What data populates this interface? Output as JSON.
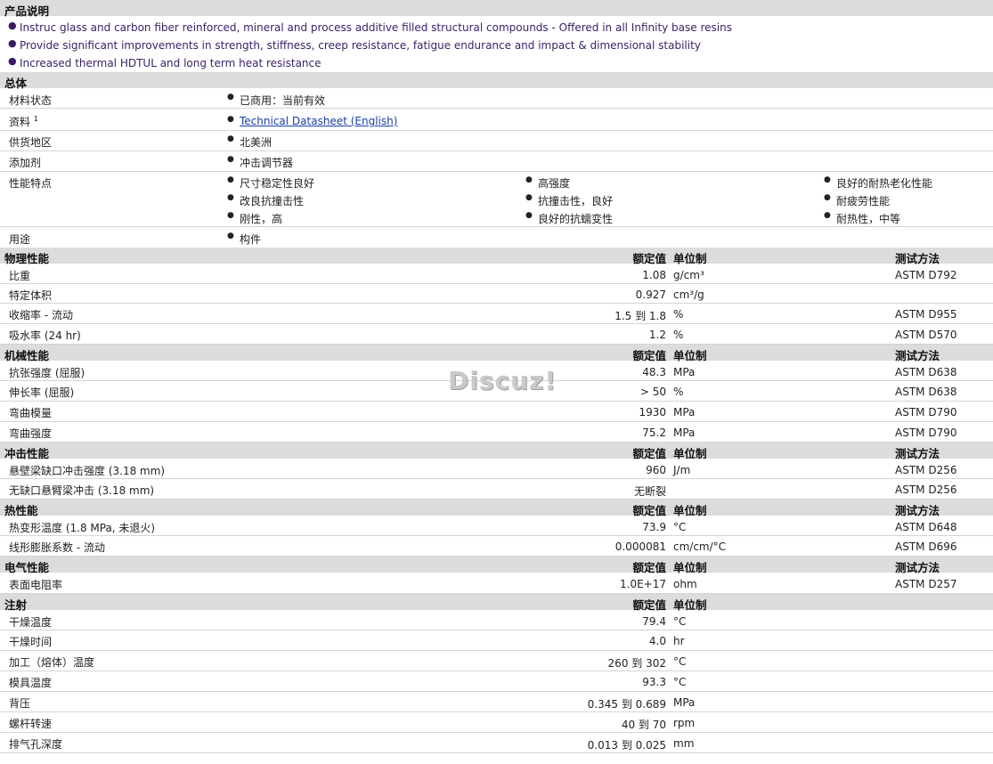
{
  "description": {
    "title": "产品说明",
    "bullets": [
      "Instruc glass and carbon fiber reinforced, mineral and process additive filled structural compounds - Offered in all Infinity base resins",
      "Provide significant improvements in strength, stiffness, creep resistance, fatigue endurance and impact & dimensional stability",
      "Increased thermal HDTUL and long term heat resistance"
    ]
  },
  "general": {
    "title": "总体",
    "status_label": "材料状态",
    "status_value": "已商用：当前有效",
    "docs_label": "资料",
    "docs_sup": "1",
    "docs_value": "Technical Datasheet (English)",
    "region_label": "供货地区",
    "region_value": "北美洲",
    "additive_label": "添加剂",
    "additive_value": "冲击调节器",
    "features_label": "性能特点",
    "features": [
      [
        "尺寸稳定性良好",
        "高强度",
        "良好的耐热老化性能"
      ],
      [
        "改良抗撞击性",
        "抗撞击性，良好",
        "耐疲劳性能"
      ],
      [
        "刚性，高",
        "良好的抗蠕变性",
        "耐热性，中等"
      ]
    ],
    "use_label": "用途",
    "use_value": "构件"
  },
  "columns": {
    "nominal": "额定值",
    "unit": "单位制",
    "method": "测试方法"
  },
  "physical": {
    "title": "物理性能",
    "rows": [
      {
        "label": "比重",
        "value": "1.08",
        "unit": "g/cm³",
        "method": "ASTM D792"
      },
      {
        "label": "特定体积",
        "value": "0.927",
        "unit": "cm³/g",
        "method": ""
      },
      {
        "label": "收缩率  - 流动",
        "value": "1.5 到  1.8",
        "unit": "%",
        "method": "ASTM D955"
      },
      {
        "label": "吸水率  (24 hr)",
        "value": "1.2",
        "unit": "%",
        "method": "ASTM D570"
      }
    ]
  },
  "mechanical": {
    "title": "机械性能",
    "rows": [
      {
        "label": "抗张强度  (屈服)",
        "value": "48.3",
        "unit": "MPa",
        "method": "ASTM D638"
      },
      {
        "label": "伸长率  (屈服)",
        "value": "> 50",
        "unit": "%",
        "method": "ASTM D638"
      },
      {
        "label": "弯曲模量",
        "value": "1930",
        "unit": "MPa",
        "method": "ASTM D790"
      },
      {
        "label": "弯曲强度",
        "value": "75.2",
        "unit": "MPa",
        "method": "ASTM D790"
      }
    ]
  },
  "impact": {
    "title": "冲击性能",
    "rows": [
      {
        "label": "悬壁梁缺口冲击强度  (3.18 mm)",
        "value": "960",
        "unit": "J/m",
        "method": "ASTM D256"
      },
      {
        "label": "无缺口悬臂梁冲击  (3.18 mm)",
        "value": "无断裂",
        "unit": "",
        "method": "ASTM D256"
      }
    ]
  },
  "thermal": {
    "title": "热性能",
    "rows": [
      {
        "label": "热变形温度  (1.8 MPa, 未退火)",
        "value": "73.9",
        "unit": "°C",
        "method": "ASTM D648"
      },
      {
        "label": "线形膨胀系数  - 流动",
        "value": "0.000081",
        "unit": "cm/cm/°C",
        "method": "ASTM D696"
      }
    ]
  },
  "electrical": {
    "title": "电气性能",
    "rows": [
      {
        "label": "表面电阻率",
        "value": "1.0E+17",
        "unit": "ohm",
        "method": "ASTM D257"
      }
    ]
  },
  "injection": {
    "title": "注射",
    "rows": [
      {
        "label": "干燥温度",
        "value": "79.4",
        "unit": "°C"
      },
      {
        "label": "干燥时间",
        "value": "4.0",
        "unit": "hr"
      },
      {
        "label": "加工（熔体）温度",
        "value": "260 到  302",
        "unit": "°C"
      },
      {
        "label": "模具温度",
        "value": "93.3",
        "unit": "°C"
      },
      {
        "label": "背压",
        "value": "0.345 到  0.689",
        "unit": "MPa"
      },
      {
        "label": "螺杆转速",
        "value": "40 到  70",
        "unit": "rpm"
      },
      {
        "label": "排气孔深度",
        "value": "0.013 到  0.025",
        "unit": "mm"
      }
    ]
  },
  "watermark": "Discuz!"
}
